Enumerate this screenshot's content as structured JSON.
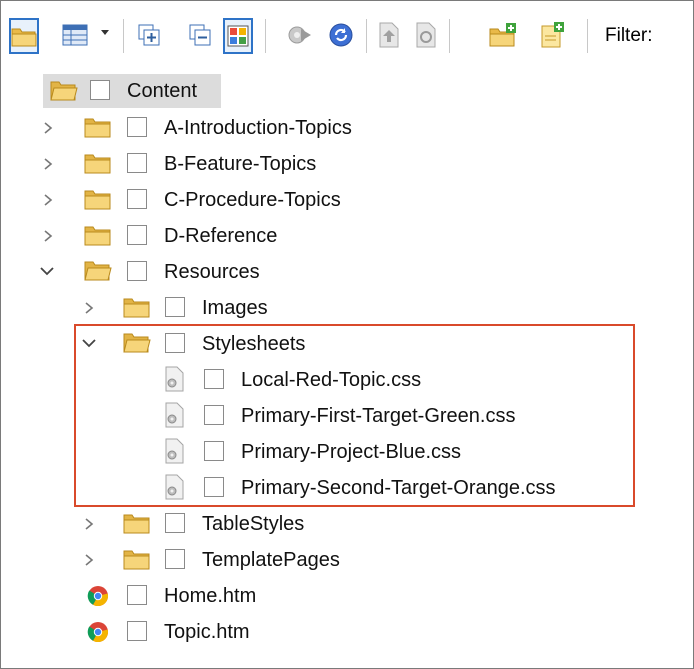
{
  "toolbar": {
    "buttons": [
      {
        "name": "open-folder-button",
        "icon": "folder-icon"
      },
      {
        "name": "view-layout-button",
        "icon": "table-layout-icon"
      },
      {
        "name": "expand-all-button",
        "icon": "expand-all-icon"
      },
      {
        "name": "collapse-all-button",
        "icon": "collapse-all-icon"
      },
      {
        "name": "color-grid-button",
        "icon": "color-grid-icon"
      },
      {
        "name": "gear-action-button",
        "icon": "gear-icon"
      },
      {
        "name": "refresh-button",
        "icon": "refresh-icon"
      },
      {
        "name": "document-up-button",
        "icon": "document-up-icon"
      },
      {
        "name": "document-edit-button",
        "icon": "document-edit-icon"
      },
      {
        "name": "new-folder-button",
        "icon": "new-folder-icon"
      },
      {
        "name": "new-file-button",
        "icon": "new-file-icon"
      }
    ],
    "filter_label": "Filter:"
  },
  "tree": {
    "root": "Content",
    "items": [
      {
        "label": "A-Introduction-Topics",
        "type": "folder",
        "expanded": false
      },
      {
        "label": "B-Feature-Topics",
        "type": "folder",
        "expanded": false
      },
      {
        "label": "C-Procedure-Topics",
        "type": "folder",
        "expanded": false
      },
      {
        "label": "D-Reference",
        "type": "folder",
        "expanded": false
      },
      {
        "label": "Resources",
        "type": "folder",
        "expanded": true
      },
      {
        "label": "Images",
        "type": "folder",
        "expanded": false
      },
      {
        "label": "Stylesheets",
        "type": "folder",
        "expanded": true
      },
      {
        "label": "Local-Red-Topic.css",
        "type": "css-file"
      },
      {
        "label": "Primary-First-Target-Green.css",
        "type": "css-file"
      },
      {
        "label": "Primary-Project-Blue.css",
        "type": "css-file"
      },
      {
        "label": "Primary-Second-Target-Orange.css",
        "type": "css-file"
      },
      {
        "label": "TableStyles",
        "type": "folder",
        "expanded": false
      },
      {
        "label": "TemplatePages",
        "type": "folder",
        "expanded": false
      },
      {
        "label": "Home.htm",
        "type": "htm-file"
      },
      {
        "label": "Topic.htm",
        "type": "htm-file"
      }
    ]
  },
  "colors": {
    "highlight_border": "#d94a2b",
    "pressed_border": "#2e73c7",
    "folder": "#f0c85a"
  }
}
